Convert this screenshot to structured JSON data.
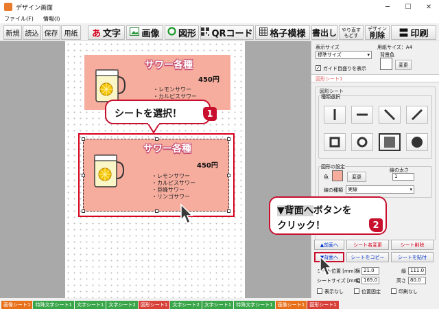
{
  "window": {
    "title": "デザイン画面",
    "minimize": "─",
    "maximize": "☐",
    "close": "✕"
  },
  "menu": [
    "ファイル(F)",
    "情報(I)"
  ],
  "toolbar": {
    "new": "新規",
    "open": "読込",
    "save": "保存",
    "paper": "用紙",
    "text": "文字",
    "text_glyph": "あ",
    "image": "画像",
    "shape": "図形",
    "qr": "QRコード",
    "grid": "格子模様",
    "output": "書出し",
    "undo_redo": [
      "やり直す",
      "もどす"
    ],
    "delete_top": "デザイン",
    "delete": "削除",
    "print": "印刷"
  },
  "card": {
    "title": "サワー各種",
    "price": "450円",
    "items": [
      "レモンサワー",
      "カルピスサワー",
      "巨峰サワー",
      "リンゴサワー"
    ],
    "top_items": [
      "レモンサワー",
      "カルピスサワー"
    ]
  },
  "callouts": {
    "select_sheet": "シートを選択！",
    "step1": "1",
    "back_button_line1_btn": "▼背面へ",
    "back_button_line1_rest": "ボタンを",
    "back_button_line2": "クリック！",
    "step2": "2"
  },
  "panel": {
    "display_size_label": "表示サイズ",
    "display_size_value": "標準サイズ",
    "paper_size_label": "用紙サイズ：A4",
    "bg_color_label": "背景色",
    "change": "変更",
    "guide_check": "✓",
    "guide_label": "ガイド目盛りを表示",
    "sheet_name": "図形シート1",
    "shape_sheet_label": "図形シート",
    "type_select_label": "種類選択",
    "shape_settings_label": "図形の設定",
    "color_label": "色",
    "line_width_label": "線の太さ",
    "line_width_value": "1",
    "line_type_label": "線の種類",
    "line_type_value": "実線",
    "btn_front_partial": "▲前面へ",
    "btn_back": "▼背面へ",
    "btn_rename": "シート名変更",
    "btn_delete": "シート削除",
    "btn_copy": "シートをコピー",
    "btn_paste": "シートを貼付",
    "sheet_pos_label": "シート位置 [mm]",
    "sheet_size_label": "シートサイズ [mm]",
    "x_label": "横",
    "x_value": "21.0",
    "y_label": "縦",
    "y_value": "111.0",
    "w_label": "幅",
    "w_value": "169.0",
    "h_label": "高さ",
    "h_value": "80.0",
    "hide_label": "表示なし",
    "fix_label": "位置固定",
    "noprint_label": "印刷なし"
  },
  "sheet_tabs": [
    {
      "label": "画像シート1",
      "color": "#e8701a"
    },
    {
      "label": "特殊文字シート1",
      "color": "#3aa64a"
    },
    {
      "label": "文字シート1",
      "color": "#3aa64a"
    },
    {
      "label": "文字シート2",
      "color": "#3aa64a"
    },
    {
      "label": "図形シート1",
      "color": "#d8403a"
    },
    {
      "label": "文字シート2",
      "color": "#3aa64a"
    },
    {
      "label": "文字シート1",
      "color": "#3aa64a"
    },
    {
      "label": "特殊文字シート1",
      "color": "#3aa64a"
    },
    {
      "label": "画像シート1",
      "color": "#e8701a"
    },
    {
      "label": "図形シート1",
      "color": "#d8403a"
    }
  ],
  "colors": {
    "accent_red": "#c8102e",
    "card_bg": "#f6ad9e",
    "shape_color": "#f6ad9e"
  }
}
